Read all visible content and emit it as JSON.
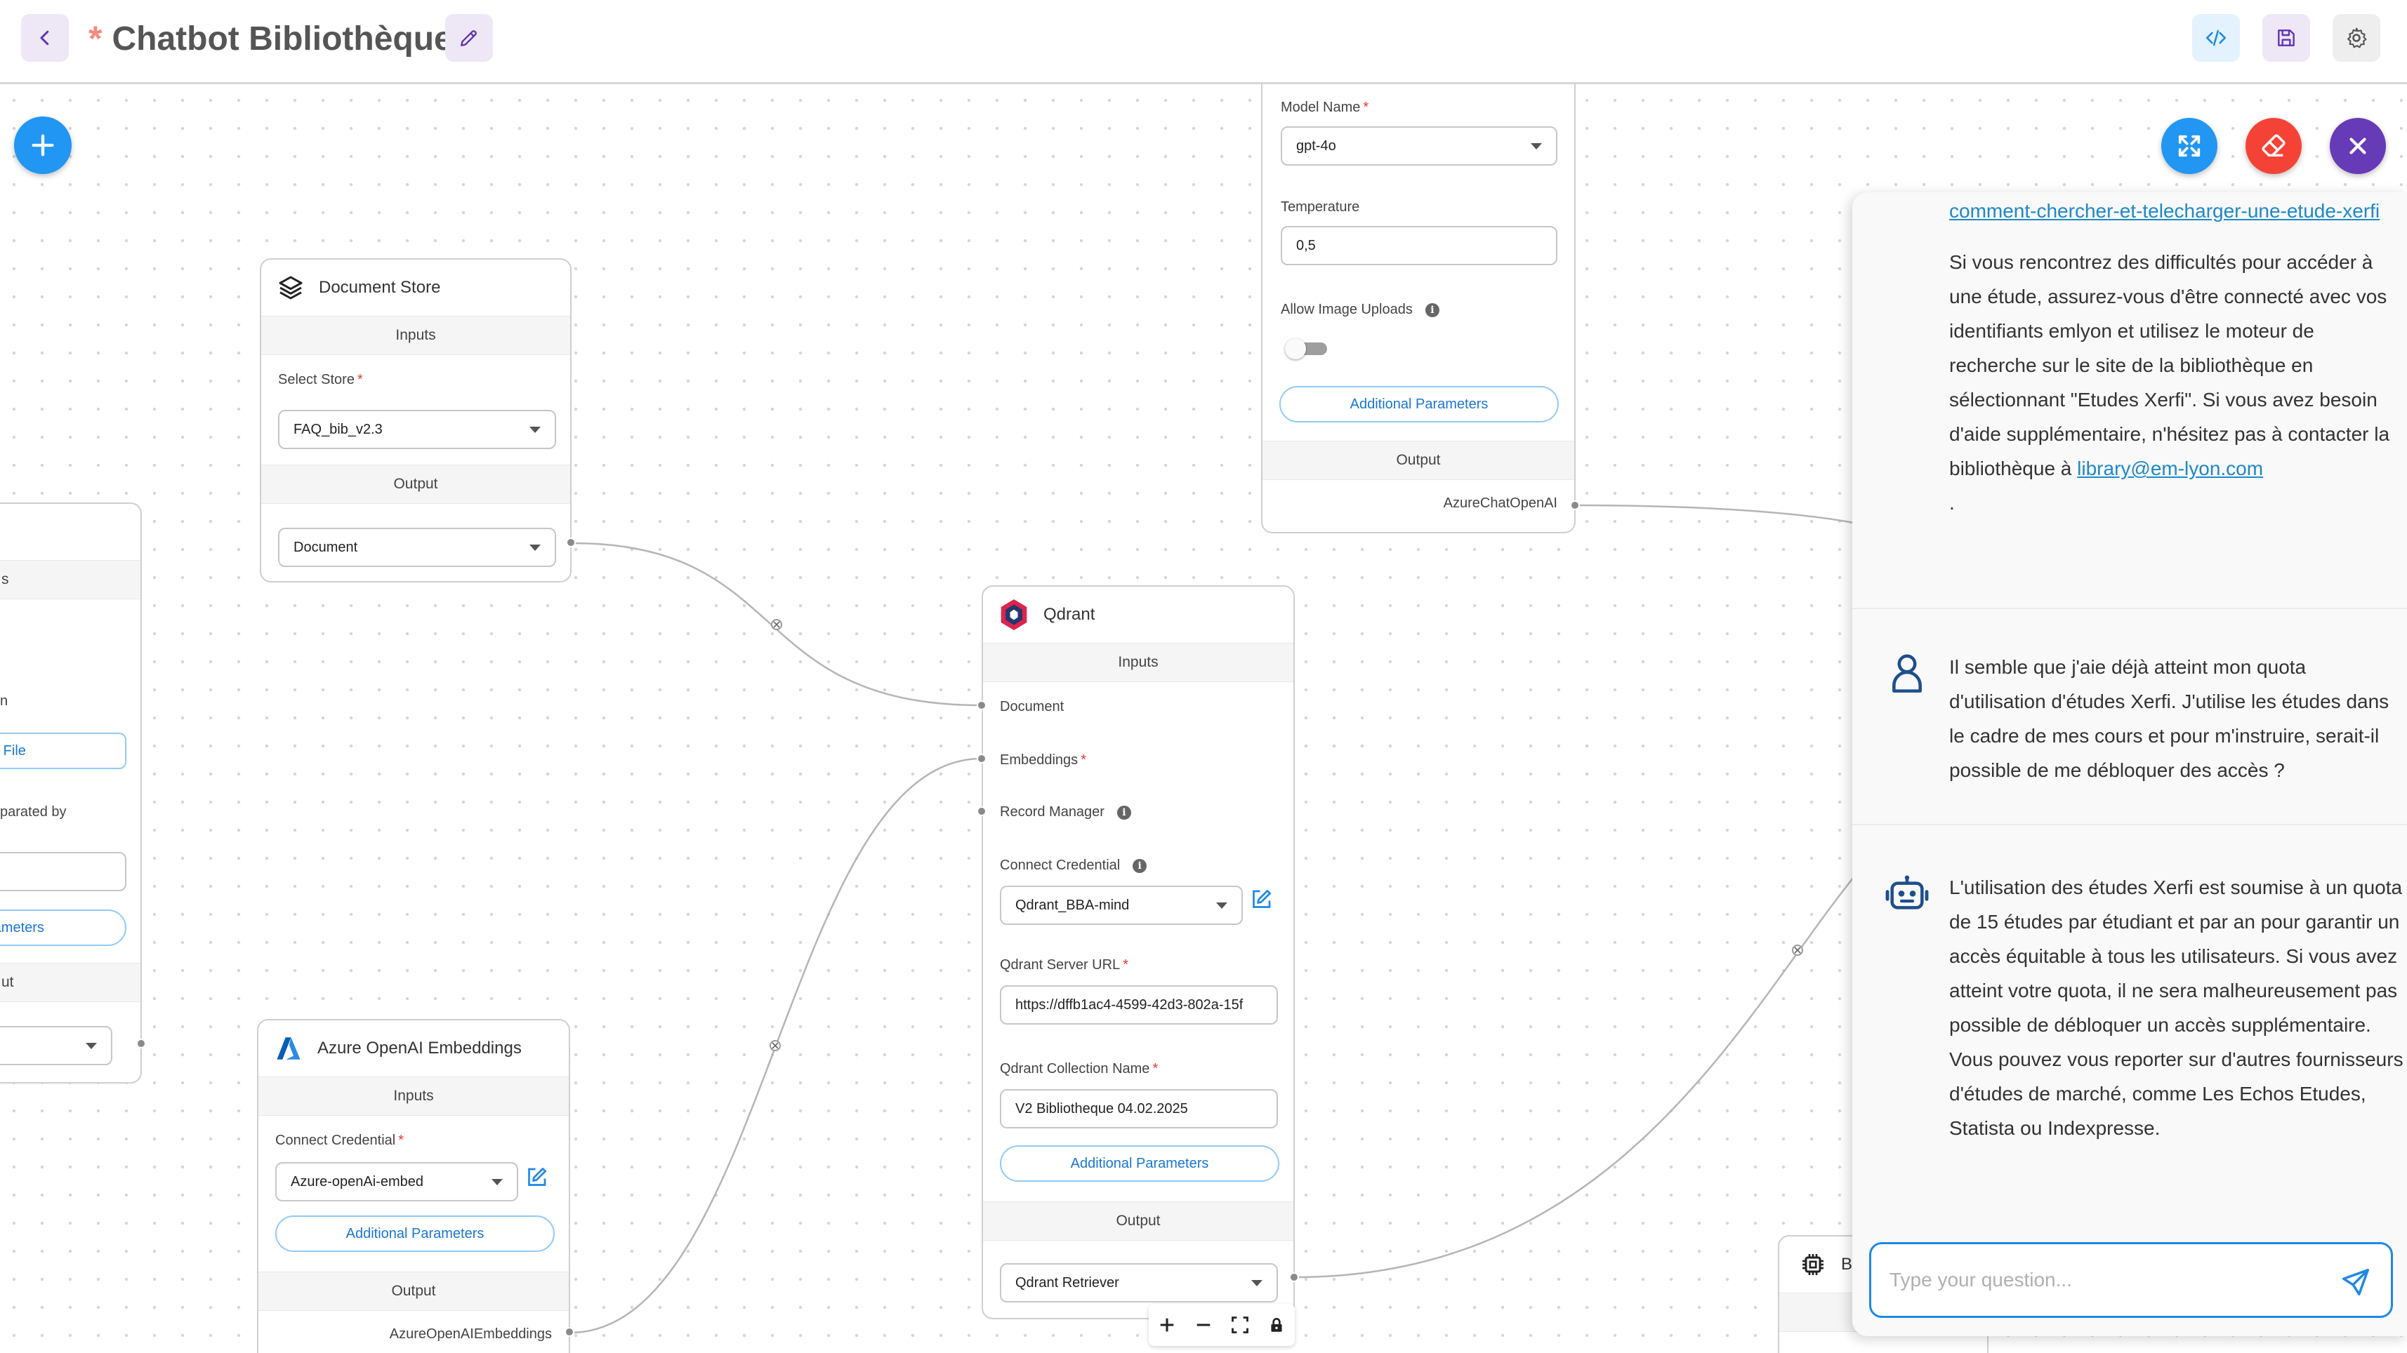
{
  "header": {
    "title": "Chatbot Bibliothèque",
    "unsaved_marker": "*"
  },
  "document_store": {
    "title": "Document Store",
    "inputs_label": "Inputs",
    "select_store_label": "Select Store",
    "select_store_value": "FAQ_bib_v2.3",
    "output_label": "Output",
    "output_value": "Document"
  },
  "left_partial_node": {
    "frag_s": "s",
    "frag_n": "n",
    "frag_file": "d File",
    "frag_separated": "parated by",
    "frag_parameters": "rameters",
    "frag_ut": "ut"
  },
  "azure_embeddings": {
    "title": "Azure OpenAI Embeddings",
    "inputs_label": "Inputs",
    "credential_label": "Connect Credential",
    "credential_value": "Azure-openAi-embed",
    "additional_params": "Additional Parameters",
    "output_label": "Output",
    "output_value": "AzureOpenAIEmbeddings"
  },
  "qdrant": {
    "title": "Qdrant",
    "inputs_label": "Inputs",
    "document_label": "Document",
    "embeddings_label": "Embeddings",
    "record_manager_label": "Record Manager",
    "credential_label": "Connect Credential",
    "credential_value": "Qdrant_BBA-mind",
    "server_url_label": "Qdrant Server URL",
    "server_url_value": "https://dffb1ac4-4599-42d3-802a-15f",
    "collection_label": "Qdrant Collection Name",
    "collection_value": "V2 Bibliotheque 04.02.2025",
    "additional_params": "Additional Parameters",
    "output_label": "Output",
    "output_value": "Qdrant Retriever"
  },
  "chat_model": {
    "model_name_label": "Model Name",
    "model_name_value": "gpt-4o",
    "temperature_label": "Temperature",
    "temperature_value": "0,5",
    "allow_uploads_label": "Allow Image Uploads",
    "additional_params": "Additional Parameters",
    "output_label": "Output",
    "output_value": "AzureChatOpenAI"
  },
  "bottom_right_node": {
    "title_frag": "B"
  },
  "chat": {
    "bot_msg_1": {
      "link_text": "comment-chercher-et-telecharger-une-etude-xerfi",
      "text": "Si vous rencontrez des difficultés pour accéder à une étude, assurez-vous d'être connecté avec vos identifiants emlyon et utilisez le moteur de recherche sur le site de la bibliothèque en sélectionnant \"Etudes Xerfi\". Si vous avez besoin d'aide supplémentaire, n'hésitez pas à contacter la bibliothèque à",
      "email": "library@em-lyon.com",
      "tail": "."
    },
    "user_msg": "Il semble que j'aie déjà atteint mon quota d'utilisation d'études Xerfi. J'utilise les études dans le cadre de mes cours et pour m'instruire, serait-il possible de me débloquer des accès ?",
    "bot_msg_2": "L'utilisation des études Xerfi est soumise à un quota de 15 études par étudiant et par an pour garantir un accès équitable à tous les utilisateurs. Si vous avez atteint votre quota, il ne sera malheureusement pas possible de débloquer un accès supplémentaire. Vous pouvez vous reporter sur d'autres fournisseurs d'études de marché, comme Les Echos Etudes, Statista ou Indexpresse.",
    "input_placeholder": "Type your question..."
  },
  "colors": {
    "accent_blue": "#1e88e5",
    "fab_add": "#2196f3",
    "fab_expand": "#2196f3",
    "fab_clear": "#f44336",
    "fab_close": "#673ab7",
    "link": "#1e88c7",
    "required": "#e53935"
  }
}
